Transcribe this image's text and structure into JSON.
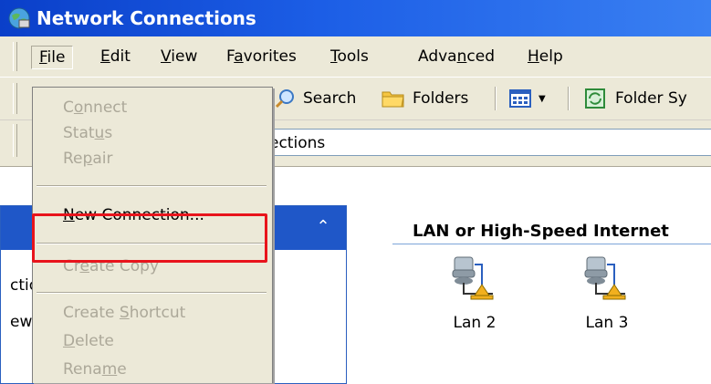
{
  "window": {
    "title": "Network Connections"
  },
  "menubar": {
    "items": [
      {
        "pre": "",
        "key": "F",
        "post": "ile"
      },
      {
        "pre": "",
        "key": "E",
        "post": "dit"
      },
      {
        "pre": "",
        "key": "V",
        "post": "iew"
      },
      {
        "pre": "F",
        "key": "a",
        "post": "vorites"
      },
      {
        "pre": "",
        "key": "T",
        "post": "ools"
      },
      {
        "pre": "Adva",
        "key": "n",
        "post": "ced"
      },
      {
        "pre": "",
        "key": "H",
        "post": "elp"
      }
    ]
  },
  "toolbar": {
    "search_label": "Search",
    "folders_label": "Folders",
    "folder_sync_label": "Folder Sy"
  },
  "address": {
    "value": "ections"
  },
  "taskpane": {
    "links": [
      "ction",
      "ewall"
    ]
  },
  "content": {
    "group_title": "LAN or High-Speed Internet",
    "connections": [
      "Lan 2",
      "Lan 3"
    ]
  },
  "file_menu": {
    "items": [
      {
        "pre": "C",
        "key": "o",
        "post": "nnect",
        "enabled": false
      },
      {
        "pre": "Stat",
        "key": "u",
        "post": "s",
        "enabled": false
      },
      {
        "pre": "Re",
        "key": "p",
        "post": "air",
        "enabled": false
      },
      {
        "pre": "",
        "key": "N",
        "post": "ew Connection...",
        "enabled": true
      },
      {
        "pre": "Cr",
        "key": "e",
        "post": "ate Copy",
        "enabled": false
      },
      {
        "pre": "Create ",
        "key": "S",
        "post": "hortcut",
        "enabled": false
      },
      {
        "pre": "",
        "key": "D",
        "post": "elete",
        "enabled": false
      },
      {
        "pre": "Rena",
        "key": "m",
        "post": "e",
        "enabled": false
      }
    ]
  },
  "colors": {
    "titlebar": "#0a3fc9",
    "highlight": "#e8141c",
    "taskpane_header": "#1f57c8"
  }
}
